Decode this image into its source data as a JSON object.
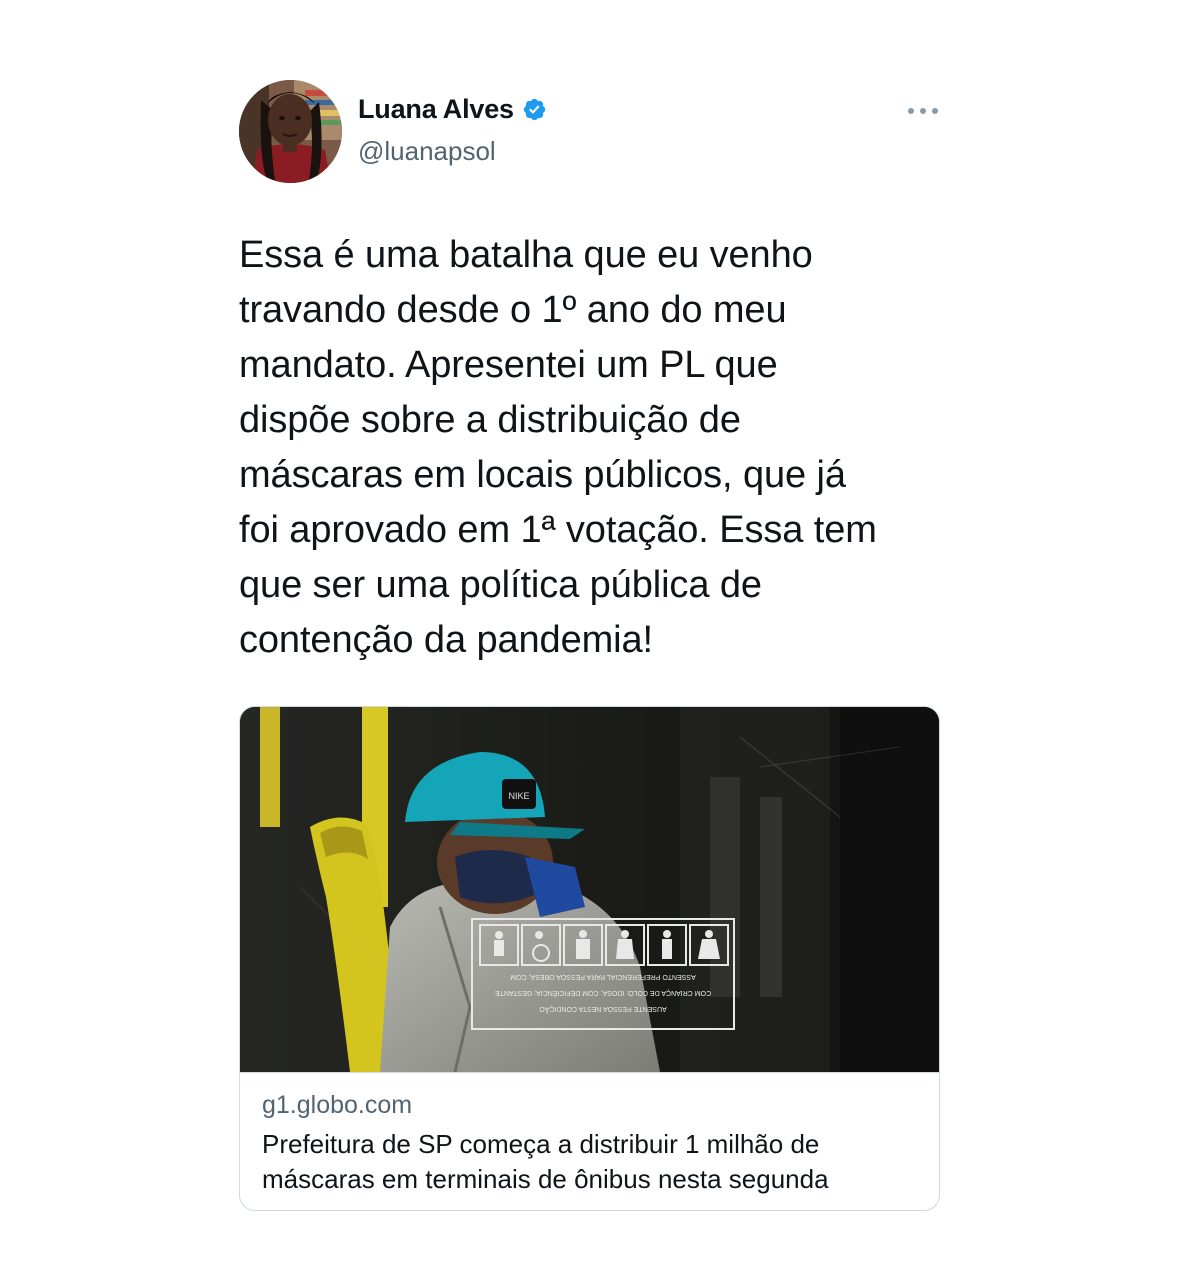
{
  "tweet": {
    "author": {
      "display_name": "Luana Alves",
      "handle": "@luanapsol",
      "verified": true,
      "avatar_icon": "profile-photo"
    },
    "more_icon": "more-horizontal-icon",
    "text": "Essa é uma batalha que eu venho\ntravando desde o 1º ano do meu\nmandato. Apresentei um PL que\ndispõe sobre a distribuição de\nmáscaras em locais públicos, que já\nfoi aprovado em 1ª votação. Essa tem\nque ser uma política pública de\ncontenção da pandemia!"
  },
  "link_card": {
    "domain": "g1.globo.com",
    "title": "Prefeitura de SP começa a distribuir 1 milhão de máscaras em terminais de ônibus nesta segunda",
    "image_icon": "bus-passenger-photo",
    "sign_text": "ASSENTO PREFERENCIAL PARA PESSOA OBESA; COM CRIANÇA DE COLO; IDOSA; COM DEFICIÊNCIA; GESTANTE; PESSOA NESTA CONDIÇÃO"
  },
  "colors": {
    "text_primary": "#0f1419",
    "text_secondary": "#536471",
    "verified_blue": "#1d9bf0",
    "border": "#cfd9de"
  }
}
